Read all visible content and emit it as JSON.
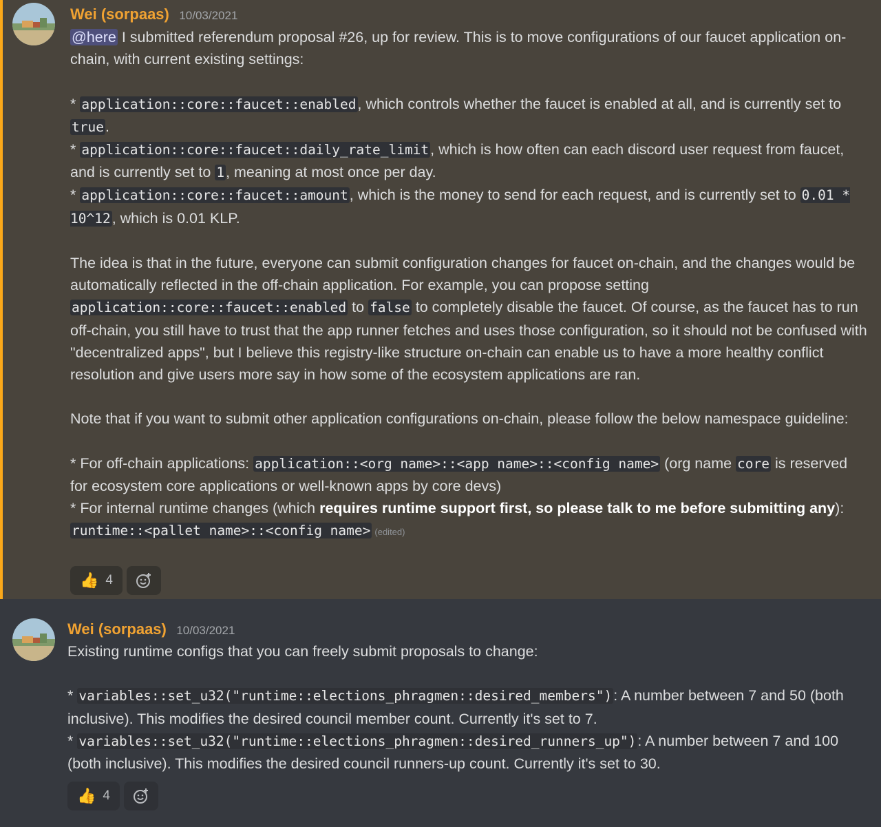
{
  "messages": [
    {
      "username": "Wei (sorpaas)",
      "timestamp": "10/03/2021",
      "mention": "@here",
      "intro": " I submitted referendum proposal #26, up for review. This is to move configurations of our faucet application on-chain, with current existing settings:",
      "settings": [
        {
          "prefix": "* ",
          "code": "application::core::faucet::enabled",
          "t1": ", which controls whether the faucet is enabled at all, and is currently set to ",
          "code2": "true",
          "t2": "."
        },
        {
          "prefix": "* ",
          "code": "application::core::faucet::daily_rate_limit",
          "t1": ", which is how often can each discord user request from faucet, and is currently set to ",
          "code2": "1",
          "t2": ", meaning at most once per day."
        },
        {
          "prefix": "* ",
          "code": "application::core::faucet::amount",
          "t1": ", which is the money to send for each request, and is currently set to ",
          "code2": "0.01 * 10^12",
          "t2": ", which is 0.01 KLP."
        }
      ],
      "idea": {
        "t1": "The idea is that in the future, everyone can submit configuration changes for faucet on-chain, and the changes would be automatically reflected in the off-chain application. For example, you can propose setting ",
        "code1": "application::core::faucet::enabled",
        "t2": " to ",
        "code2": "false",
        "t3": " to completely disable the faucet. Of course, as the faucet has to run off-chain, you still have to trust that the app runner fetches and uses those configuration, so it should not be confused with \"decentralized apps\", but I believe this registry-like structure on-chain can enable us to have a more healthy conflict resolution and give users more say in how some of the ecosystem applications are ran."
      },
      "note": "Note that if you want to submit other application configurations on-chain, please follow the below namespace guideline:",
      "guide1": {
        "t1": "* For off-chain applications: ",
        "code1": "application::<org name>::<app name>::<config name>",
        "t2": " (org name ",
        "code2": "core",
        "t3": " is reserved for ecosystem core applications or well-known apps by core devs)"
      },
      "guide2": {
        "t1": "* For internal runtime changes (which ",
        "bold": "requires runtime support first, so please talk to me before submitting any",
        "t2": "): ",
        "code1": "runtime::<pallet name>::<config name>"
      },
      "edited": "(edited)",
      "reaction_emoji": "👍",
      "reaction_count": "4"
    },
    {
      "username": "Wei (sorpaas)",
      "timestamp": "10/03/2021",
      "intro": "Existing runtime configs that you can freely submit proposals to change:",
      "items": [
        {
          "prefix": "* ",
          "code": "variables::set_u32(\"runtime::elections_phragmen::desired_members\")",
          "t1": ": A number between 7 and 50 (both inclusive). This modifies the desired council member count. Currently it's set to 7."
        },
        {
          "prefix": "* ",
          "code": "variables::set_u32(\"runtime::elections_phragmen::desired_runners_up\")",
          "t1": ": A number between 7 and 100 (both inclusive). This modifies the desired council runners-up count. Currently it's set to 30."
        }
      ],
      "reaction_emoji": "👍",
      "reaction_count": "4"
    }
  ],
  "colors": {
    "highlight_bg": "#49443c",
    "highlight_bar": "#faa81a",
    "username": "#f0a232",
    "background": "#36393f"
  },
  "icons": {
    "add_reaction": "smiley-plus-icon",
    "avatar": "landscape-avatar"
  }
}
